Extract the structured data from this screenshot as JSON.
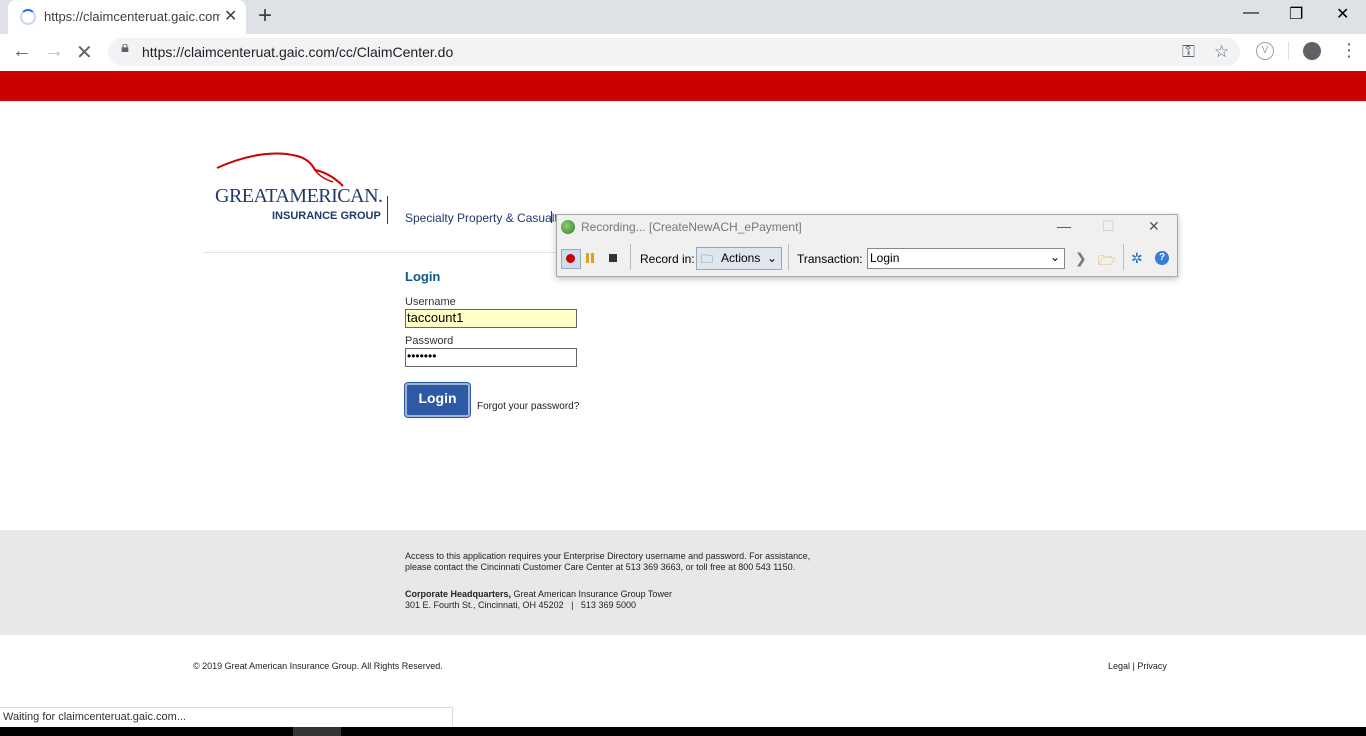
{
  "browser": {
    "tab_title": "https://claimcenteruat.gaic.com/c",
    "tab_close": "✕",
    "new_tab": "+",
    "url": "https://claimcenteruat.gaic.com/cc/ClaimCenter.do",
    "status_text": "Waiting for claimcenteruat.gaic.com..."
  },
  "header": {
    "logo_main": "GREATAMERICAN.",
    "logo_sub": "INSURANCE GROUP",
    "specialty": "Specialty Property & Casualty"
  },
  "login": {
    "title": "Login",
    "username_label": "Username",
    "username_value": "taccount1",
    "password_label": "Password",
    "password_value": "•••••••",
    "button": "Login",
    "forgot": "Forgot your password?"
  },
  "footer": {
    "notice": "Access to this application requires your Enterprise Directory username and password. For assistance, please contact the Cincinnati Customer Care Center at 513 369 3663, or toll free at 800 543 1150.",
    "hq_bold": "Corporate Headquarters,",
    "hq_rest": " Great American Insurance Group Tower",
    "address": "301 E. Fourth St., Cincinnati, OH 45202   |   513 369 5000",
    "copyright": "© 2019 Great American Insurance Group. All Rights Reserved.",
    "legal": "Legal | Privacy"
  },
  "recorder": {
    "title": "Recording... [CreateNewACH_ePayment]",
    "record_in_label": "Record in:",
    "record_in_value": "Actions",
    "transaction_label": "Transaction:",
    "transaction_value": "Login"
  },
  "colors": {
    "brand_red": "#cc0000",
    "brand_navy": "#1f3a6b",
    "login_blue": "#2e5aa5"
  }
}
